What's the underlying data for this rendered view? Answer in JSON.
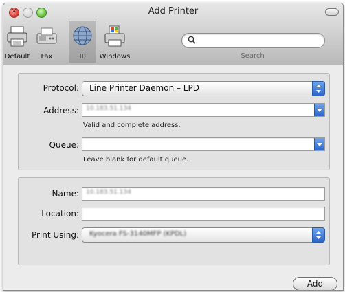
{
  "window": {
    "title": "Add Printer"
  },
  "toolbar": {
    "items": [
      {
        "label": "Default"
      },
      {
        "label": "Fax"
      },
      {
        "label": "IP"
      },
      {
        "label": "Windows"
      }
    ],
    "selected": "IP",
    "search": {
      "label": "Search",
      "value": ""
    }
  },
  "connection": {
    "protocol_label": "Protocol:",
    "protocol_value": "Line Printer Daemon – LPD",
    "address_label": "Address:",
    "address_value": "10.183.51.134",
    "address_hint": "Valid and complete address.",
    "queue_label": "Queue:",
    "queue_value": "",
    "queue_hint": "Leave blank for default queue."
  },
  "details": {
    "name_label": "Name:",
    "name_value": "10.183.51.134",
    "location_label": "Location:",
    "location_value": "",
    "print_using_label": "Print Using:",
    "print_using_value": "Kyocera FS-3140MFP (KPDL)"
  },
  "actions": {
    "add_label": "Add"
  },
  "colors": {
    "accent": "#2b65c9",
    "window_bg": "#ececec"
  }
}
